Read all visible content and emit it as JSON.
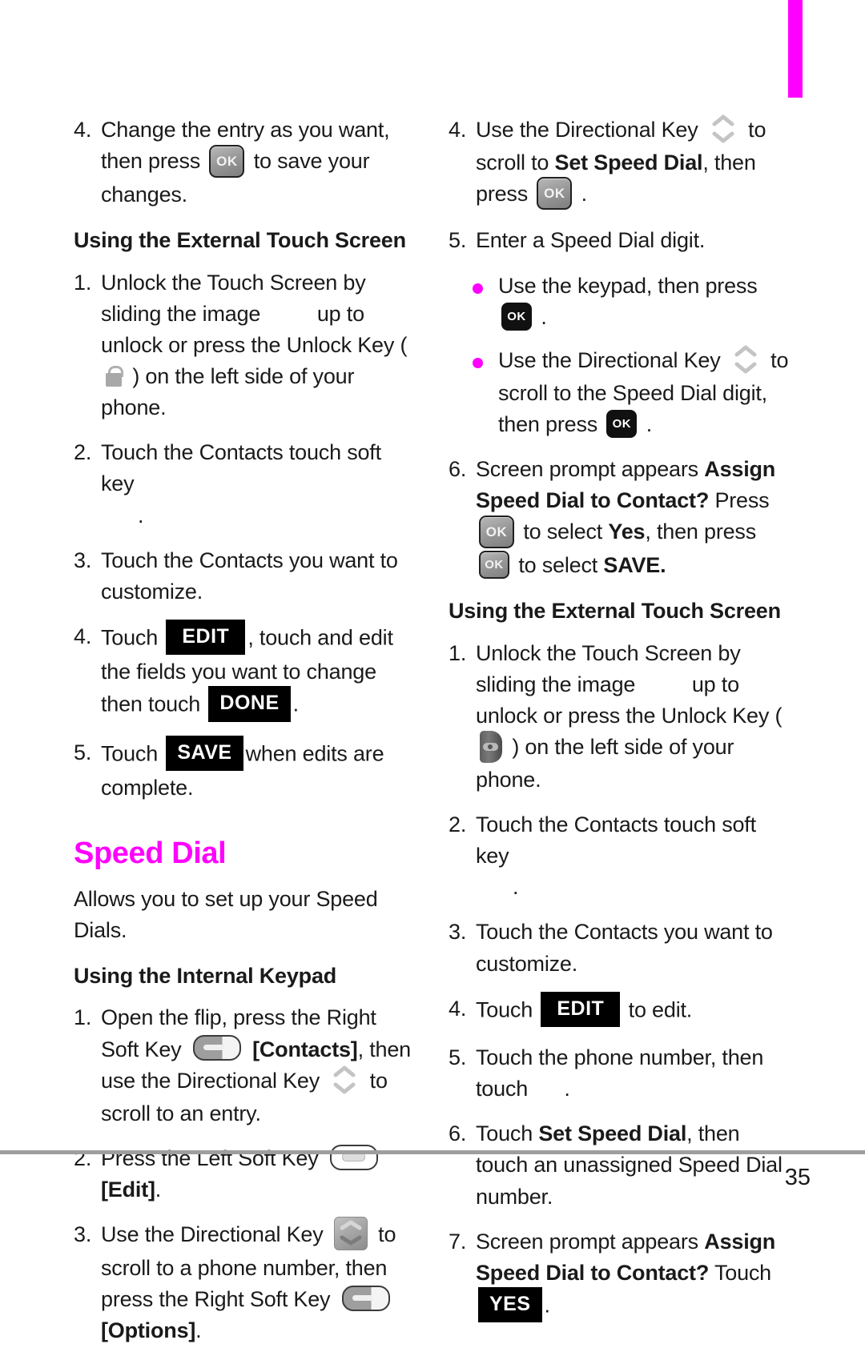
{
  "colors": {
    "accent": "#ff00ff",
    "chip_bg": "#000000",
    "chip_fg": "#ffffff",
    "rule": "#9e9e9e"
  },
  "icons": {
    "ok_key": "OK",
    "directional_key": "up-down-chevron-icon",
    "left_soft_key": "left-soft-key-icon",
    "right_soft_key": "right-soft-key-icon",
    "unlock_key": "unlock-key-icon"
  },
  "labels": {
    "edit": "EDIT",
    "done": "DONE",
    "save": "SAVE",
    "yes": "YES"
  },
  "left_column": {
    "step4_num": "4.",
    "step4_a": "Change the entry as you want, then press",
    "step4_b": "to save your changes.",
    "heading_external": "Using the External Touch Screen",
    "s1_num": "1.",
    "s1_a": "Unlock the Touch Screen by sliding the image",
    "s1_b": "up to unlock or press the Unlock Key",
    "s1_c": "(",
    "s1_d": ") on the left side of your phone.",
    "s2_num": "2.",
    "s2_a": "Touch the Contacts touch soft key",
    "s2_b": ".",
    "s3_num": "3.",
    "s3_a": "Touch the Contacts you want to customize.",
    "s4_num": "4.",
    "s4_a": "Touch",
    "s4_b": ",  touch and edit the fields you want to change then touch",
    "s4_c": ".",
    "s5_num": "5.",
    "s5_a": "Touch",
    "s5_b": "when edits are complete.",
    "section_title": "Speed Dial",
    "section_intro": "Allows you to set up your Speed Dials.",
    "heading_internal": "Using the Internal Keypad",
    "k1_num": "1.",
    "k1_a": "Open the flip, press the Right Soft Key",
    "k1_b": "[Contacts]",
    "k1_c": ", then use the Directional Key",
    "k1_d": "to scroll to an entry.",
    "k2_num": "2.",
    "k2_a": "Press the Left Soft Key",
    "k2_b": "[Edit]",
    "k2_c": ".",
    "k3_num": "3.",
    "k3_a": "Use the Directional Key",
    "k3_b": "to scroll to a phone number, then press the Right Soft Key",
    "k3_c": "[Options]",
    "k3_d": "."
  },
  "right_column": {
    "r4_num": "4.",
    "r4_a": "Use the Directional Key",
    "r4_b": "to scroll to",
    "r4_bold": "Set Speed Dial",
    "r4_c": ", then press",
    "r4_d": ".",
    "r5_num": "5.",
    "r5_a": "Enter a Speed Dial digit.",
    "b1_a": "Use the keypad, then press",
    "b1_b": ".",
    "b2_a": "Use the Directional Key",
    "b2_b": "to scroll to the Speed Dial digit, then press",
    "b2_c": ".",
    "r6_num": "6.",
    "r6_a": "Screen prompt appears",
    "r6_bold1": "Assign Speed Dial to Contact?",
    "r6_b": "Press",
    "r6_c": "to select",
    "r6_bold2": "Yes",
    "r6_d": ", then press",
    "r6_e": "to select",
    "r6_bold3": "SAVE.",
    "heading_external": "Using the External Touch Screen",
    "t1_num": "1.",
    "t1_a": "Unlock the Touch Screen by sliding the image",
    "t1_b": "up to unlock or press the Unlock Key",
    "t1_c": "(",
    "t1_d": ") on the left side of your phone.",
    "t2_num": "2.",
    "t2_a": "Touch the Contacts touch soft key",
    "t2_b": ".",
    "t3_num": "3.",
    "t3_a": "Touch the Contacts you want to customize.",
    "t4_num": "4.",
    "t4_a": "Touch",
    "t4_b": "to edit.",
    "t5_num": "5.",
    "t5_a": "Touch the phone number, then touch",
    "t5_b": ".",
    "t6_num": "6.",
    "t6_a": "Touch",
    "t6_bold": "Set Speed Dial",
    "t6_b": ", then touch an unassigned Speed Dial number.",
    "t7_num": "7.",
    "t7_a": "Screen prompt appears",
    "t7_bold": "Assign Speed Dial to Contact?",
    "t7_b": "Touch",
    "t7_c": "."
  },
  "footer": {
    "page_number": "35"
  }
}
